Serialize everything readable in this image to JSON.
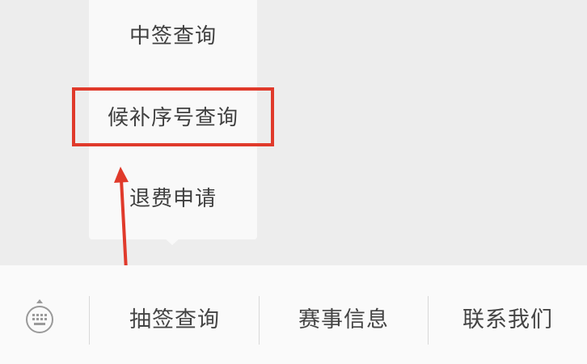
{
  "popup_menu": {
    "items": [
      {
        "label": "中签查询"
      },
      {
        "label": "候补序号查询"
      },
      {
        "label": "退费申请"
      }
    ]
  },
  "bottom_menu": {
    "keyboard_icon": "keyboard-icon",
    "tabs": [
      {
        "label": "抽签查询"
      },
      {
        "label": "赛事信息"
      },
      {
        "label": "联系我们"
      }
    ]
  },
  "annotation": {
    "highlight_color": "#e03a2b"
  }
}
